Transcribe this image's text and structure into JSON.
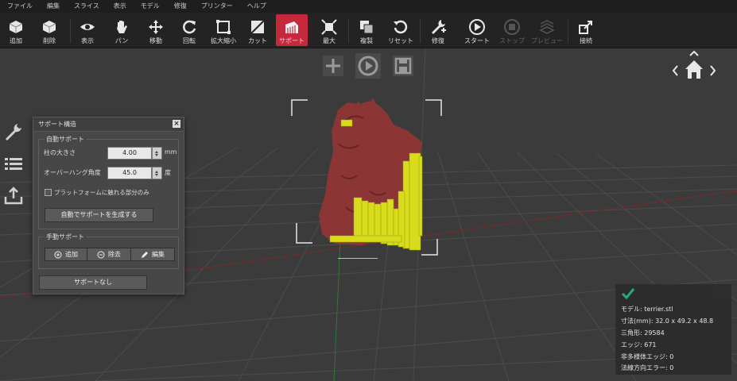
{
  "menu": [
    "ファイル",
    "編集",
    "スライス",
    "表示",
    "モデル",
    "修復",
    "プリンター",
    "ヘルプ"
  ],
  "toolbar": [
    {
      "label": "追加",
      "icon": "add-cube-icon"
    },
    {
      "label": "削除",
      "icon": "delete-cube-icon"
    },
    {
      "label": "表示",
      "icon": "eye-icon"
    },
    {
      "label": "パン",
      "icon": "hand-icon"
    },
    {
      "label": "移動",
      "icon": "move-arrows-icon"
    },
    {
      "label": "回転",
      "icon": "rotate-icon"
    },
    {
      "label": "拡大縮小",
      "icon": "scale-icon"
    },
    {
      "label": "カット",
      "icon": "cut-icon"
    },
    {
      "label": "サポート",
      "icon": "support-icon"
    },
    {
      "label": "最大",
      "icon": "maximize-icon"
    },
    {
      "label": "複製",
      "icon": "duplicate-icon"
    },
    {
      "label": "リセット",
      "icon": "reset-icon"
    },
    {
      "label": "修復",
      "icon": "repair-icon"
    },
    {
      "label": "スタート",
      "icon": "play-icon"
    },
    {
      "label": "ストップ",
      "icon": "stop-icon"
    },
    {
      "label": "プレビュー",
      "icon": "preview-icon"
    },
    {
      "label": "接続",
      "icon": "connect-icon"
    }
  ],
  "support_panel": {
    "title": "サポート構造",
    "auto_group": "自動サポート",
    "pillar_size_label": "柱の大きさ",
    "pillar_size_value": "4.00",
    "pillar_size_unit": "mm",
    "overhang_label": "オーバーハング角度",
    "overhang_value": "45.0",
    "overhang_unit": "度",
    "platform_only_label": "プラットフォームに触れる部分のみ",
    "generate_button": "自動でサポートを生成する",
    "manual_group": "手動サポート",
    "add_button": "追加",
    "remove_button": "除去",
    "edit_button": "編集",
    "no_support_button": "サポートなし"
  },
  "model_info": {
    "model": "モデル: terrier.stl",
    "dimensions": "寸法(mm): 32.0 x 49.2 x 48.8",
    "triangles": "三角形: 29584",
    "edges": "エッジ: 671",
    "non_manifold": "非多様体エッジ: 0",
    "normal_errors": "法線方向エラー: 0"
  },
  "colors": {
    "accent": "#c8283c",
    "model": "#8a3434",
    "support": "#d8dc1a",
    "check": "#21b08c"
  }
}
